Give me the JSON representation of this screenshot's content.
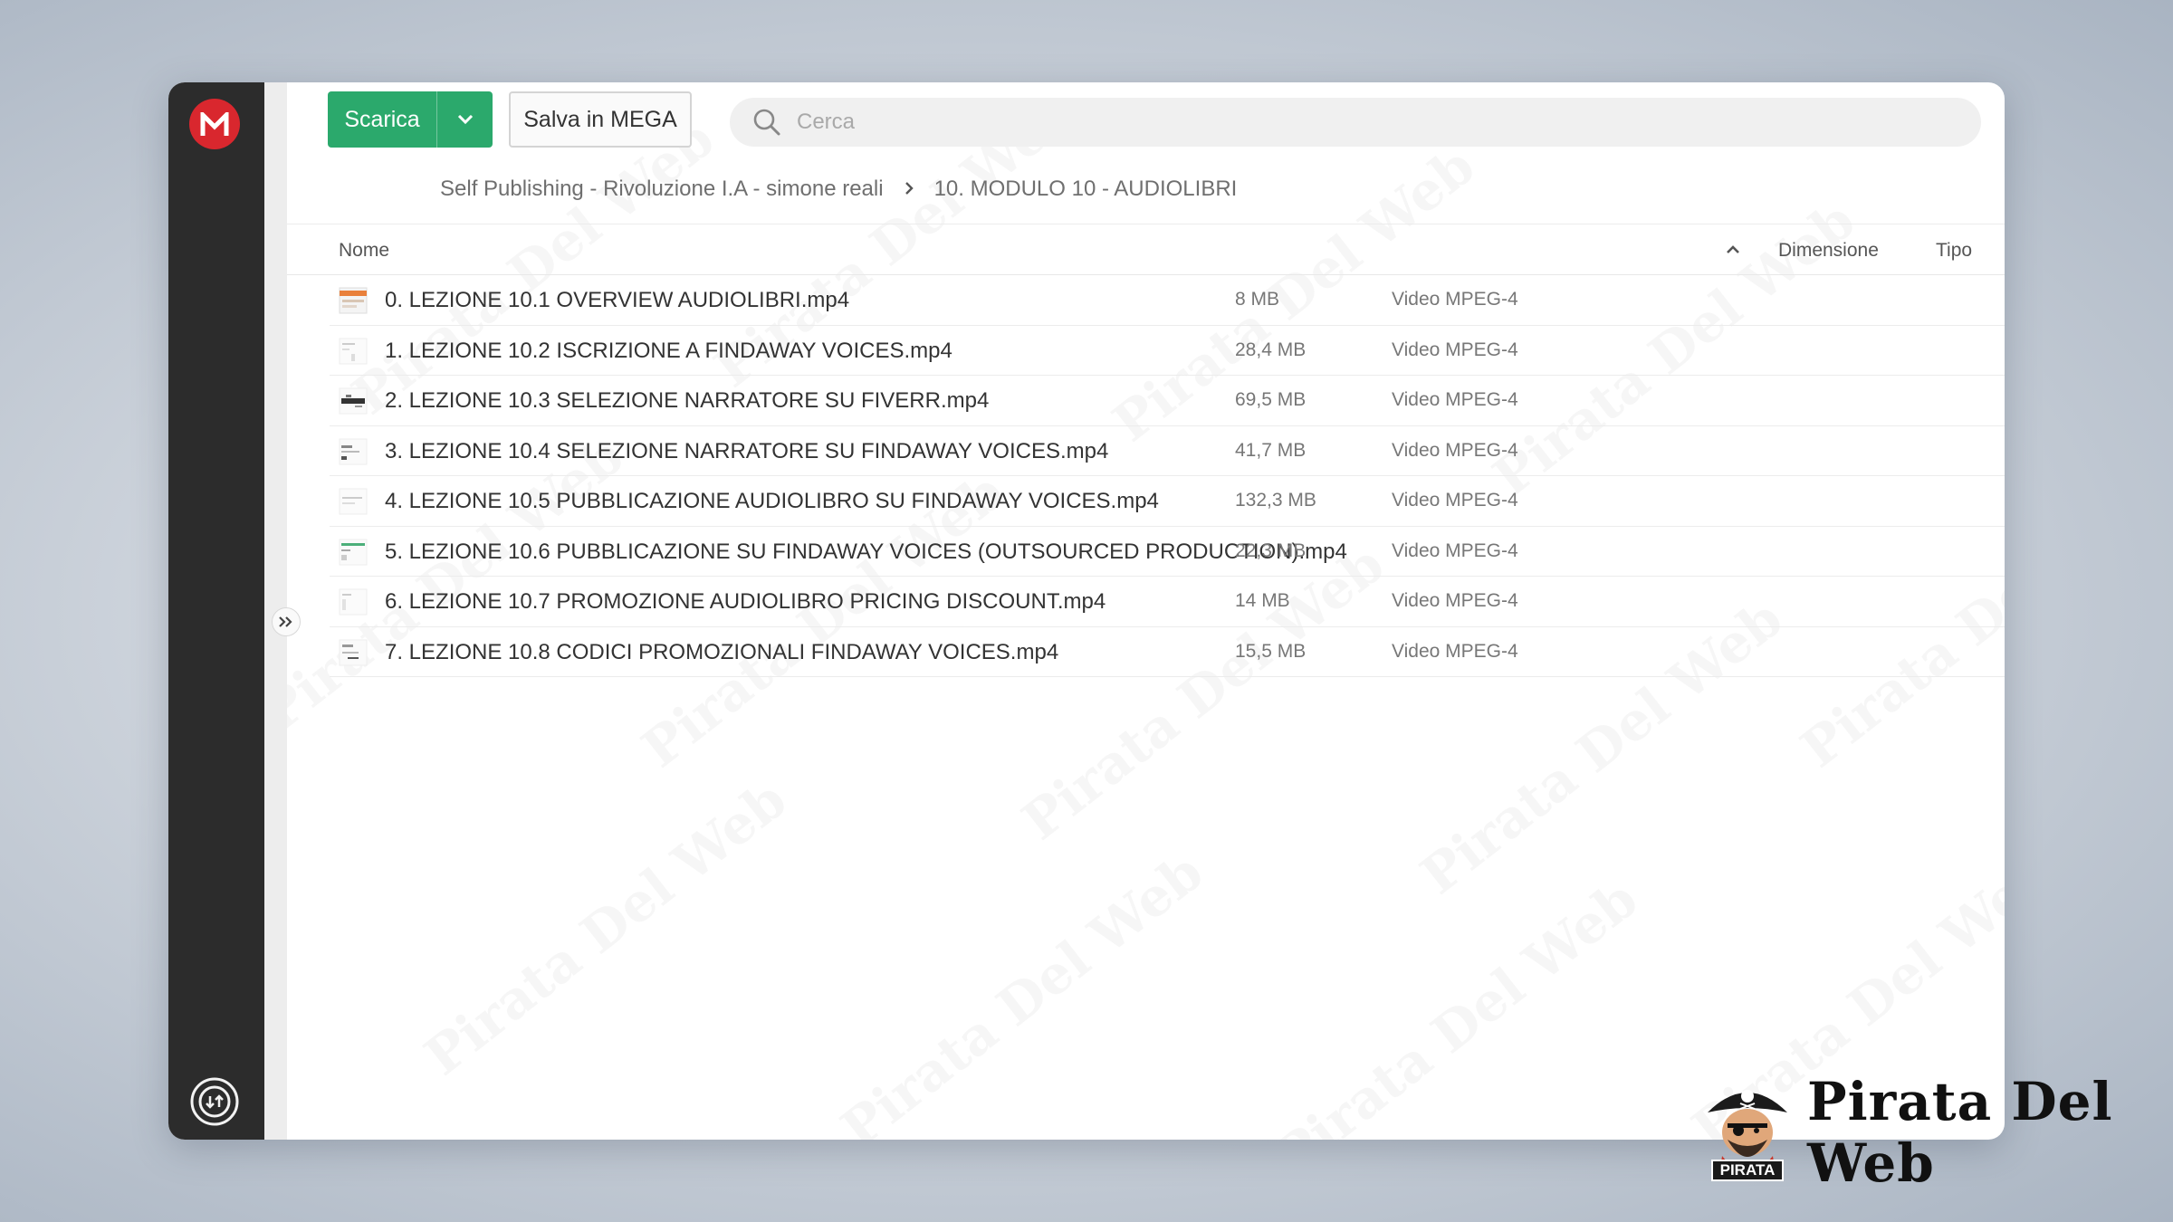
{
  "toolbar": {
    "download_label": "Scarica",
    "save_label": "Salva in MEGA"
  },
  "search": {
    "placeholder": "Cerca"
  },
  "breadcrumb": {
    "parent": "Self Publishing - Rivoluzione I.A - simone reali",
    "current": "10. MODULO 10 - AUDIOLIBRI"
  },
  "columns": {
    "name": "Nome",
    "size": "Dimensione",
    "type": "Tipo"
  },
  "files": [
    {
      "name": "0. LEZIONE 10.1 OVERVIEW AUDIOLIBRI.mp4",
      "size": "8 MB",
      "type": "Video MPEG-4"
    },
    {
      "name": "1. LEZIONE 10.2 ISCRIZIONE A FINDAWAY VOICES.mp4",
      "size": "28,4 MB",
      "type": "Video MPEG-4"
    },
    {
      "name": "2. LEZIONE 10.3 SELEZIONE NARRATORE SU FIVERR.mp4",
      "size": "69,5 MB",
      "type": "Video MPEG-4"
    },
    {
      "name": "3. LEZIONE 10.4 SELEZIONE NARRATORE SU FINDAWAY VOICES.mp4",
      "size": "41,7 MB",
      "type": "Video MPEG-4"
    },
    {
      "name": "4. LEZIONE 10.5 PUBBLICAZIONE AUDIOLIBRO SU FINDAWAY VOICES.mp4",
      "size": "132,3 MB",
      "type": "Video MPEG-4"
    },
    {
      "name": "5. LEZIONE 10.6 PUBBLICAZIONE SU FINDAWAY VOICES (OUTSOURCED PRODUCTION).mp4",
      "size": "22,3 MB",
      "type": "Video MPEG-4"
    },
    {
      "name": "6. LEZIONE 10.7 PROMOZIONE AUDIOLIBRO PRICING DISCOUNT.mp4",
      "size": "14 MB",
      "type": "Video MPEG-4"
    },
    {
      "name": "7. LEZIONE 10.8 CODICI PROMOZIONALI FINDAWAY VOICES.mp4",
      "size": "15,5 MB",
      "type": "Video MPEG-4"
    }
  ],
  "watermark": {
    "text": "Pirata Del Web"
  },
  "brand": {
    "name": "Pirata Del Web",
    "badge": "PIRATA"
  },
  "icons": {
    "logo": "mega-logo-icon",
    "sync": "transfer-sync-icon",
    "expand": "double-chevron-right-icon",
    "search": "search-icon",
    "dropdown": "chevron-down-icon",
    "sort": "chevron-up-icon",
    "thumbnail": "video-thumbnail-icon"
  },
  "colors": {
    "accent_green": "#2ba96c",
    "mega_red": "#d9272e",
    "sidebar": "#2c2c2c"
  }
}
